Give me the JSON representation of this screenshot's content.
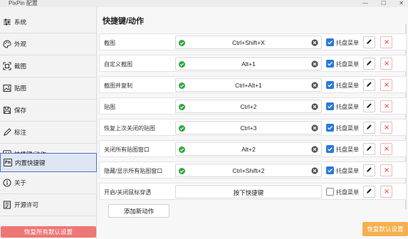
{
  "window": {
    "title": "PixPin 配置",
    "minimize": "—",
    "maximize": "☐",
    "close": "✕"
  },
  "sidebar": {
    "items": [
      {
        "label": "系统",
        "icon": "sliders-icon"
      },
      {
        "label": "外观",
        "icon": "palette-icon"
      },
      {
        "label": "截图",
        "icon": "screenshot-icon"
      },
      {
        "label": "贴图",
        "icon": "pin-image-icon"
      },
      {
        "label": "保存",
        "icon": "save-icon"
      },
      {
        "label": "标注",
        "icon": "pencil-icon"
      },
      {
        "label": "快捷键/动作",
        "icon": "hash-icon"
      },
      {
        "label": "内置快捷键",
        "icon": "fn-key-icon",
        "badge": "Fn",
        "active": true
      },
      {
        "label": "关于",
        "icon": "info-icon"
      },
      {
        "label": "开源许可",
        "icon": "license-icon"
      }
    ],
    "reset_all_label": "恢复所有默认设置"
  },
  "main": {
    "title": "快捷键/动作",
    "tray_label": "托盘菜单",
    "rows": [
      {
        "action": "截图",
        "key": "Ctrl+Shift+X",
        "valid": true,
        "tray": true
      },
      {
        "action": "自定义截图",
        "key": "Alt+1",
        "valid": true,
        "tray": true
      },
      {
        "action": "截图并复制",
        "key": "Ctrl+Alt+1",
        "valid": true,
        "tray": true
      },
      {
        "action": "贴图",
        "key": "Ctrl+2",
        "valid": true,
        "tray": true
      },
      {
        "action": "恢复上次关闭的贴图",
        "key": "Ctrl+3",
        "valid": true,
        "tray": true
      },
      {
        "action": "关闭所有贴图窗口",
        "key": "Alt+2",
        "valid": true,
        "tray": true
      },
      {
        "action": "隐藏/显示所有贴图窗口",
        "key": "Ctrl+Shift+2",
        "valid": true,
        "tray": true
      },
      {
        "action": "开启/关闭鼠标穿透",
        "key": "按下快捷键",
        "valid": false,
        "tray": false
      }
    ],
    "add_action_label": "添加新动作",
    "reset_default_label": "恢复默认设置"
  },
  "colors": {
    "accent": "#2b7ad8",
    "success": "#2eaa3f",
    "danger": "#e05a5a",
    "reset_all": "#ef7676",
    "reset_default": "#f4b04e"
  }
}
